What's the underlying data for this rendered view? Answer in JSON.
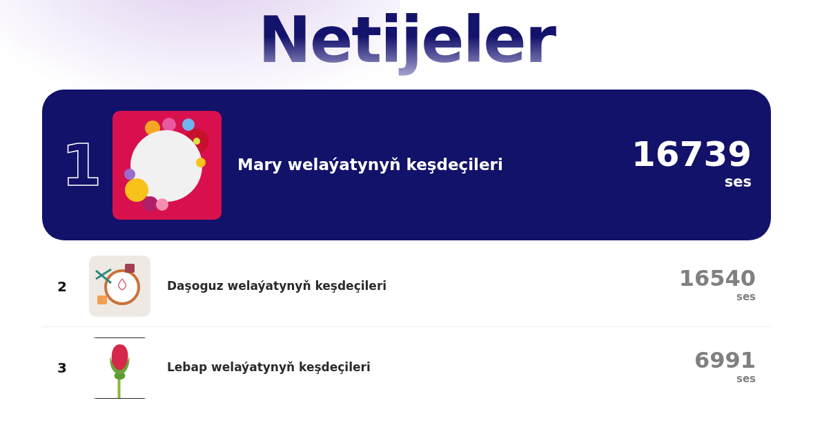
{
  "title": "Netijeler",
  "results": [
    {
      "kind": "featured",
      "rank": "1",
      "name": "Mary welaýatynyň keşdeçileri",
      "votes": "16739",
      "unit": "ses"
    },
    {
      "kind": "regular",
      "rank": "2",
      "name": "Daşoguz welaýatynyň keşdeçileri",
      "votes": "16540",
      "unit": "ses"
    },
    {
      "kind": "regular",
      "rank": "3",
      "name": "Lebap welaýatynyň keşdeçileri",
      "votes": "6991",
      "unit": "ses"
    }
  ]
}
